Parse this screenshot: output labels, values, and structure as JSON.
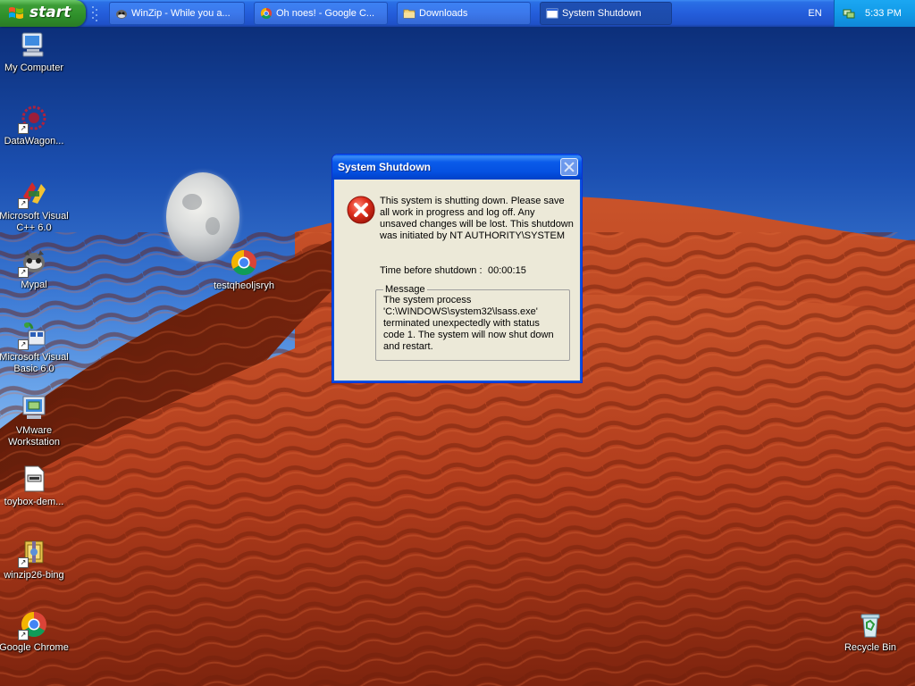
{
  "taskbar": {
    "start_label": "start",
    "buttons": [
      {
        "label": "WinZip - While you a...",
        "icon": "winzip-icon"
      },
      {
        "label": "Oh noes! - Google C...",
        "icon": "chrome-icon"
      },
      {
        "label": "Downloads",
        "icon": "folder-icon"
      },
      {
        "label": "System Shutdown",
        "icon": "window-icon",
        "active": true
      }
    ],
    "language": "EN",
    "clock": "5:33 PM"
  },
  "desktop_icons": [
    {
      "label": "My Computer",
      "icon": "computer-icon"
    },
    {
      "label": "DataWagon...",
      "icon": "datawagon-icon"
    },
    {
      "label": "Microsoft Visual C++ 6.0",
      "icon": "visual-cpp-icon"
    },
    {
      "label": "Mypal",
      "icon": "mypal-icon"
    },
    {
      "label": "Microsoft Visual Basic 6.0",
      "icon": "visual-basic-icon"
    },
    {
      "label": "VMware Workstation",
      "icon": "vmware-icon"
    },
    {
      "label": "toybox-dem...",
      "icon": "document-icon"
    },
    {
      "label": "winzip26-bing",
      "icon": "winzip-installer-icon"
    },
    {
      "label": "Google Chrome",
      "icon": "chrome-icon"
    },
    {
      "label": "testqheoljsryh",
      "icon": "chrome-icon"
    },
    {
      "label": "Recycle Bin",
      "icon": "recycle-bin-icon"
    }
  ],
  "dialog": {
    "title": "System Shutdown",
    "message": "This system is shutting down. Please save all work in progress and log off. Any unsaved changes will be lost. This shutdown was initiated by NT AUTHORITY\\SYSTEM",
    "time_label": "Time before shutdown :",
    "time_value": "00:00:15",
    "group_label": "Message",
    "group_text": "The system process 'C:\\WINDOWS\\system32\\lsass.exe' terminated unexpectedly with status code 1.  The system will now shut down and restart."
  }
}
